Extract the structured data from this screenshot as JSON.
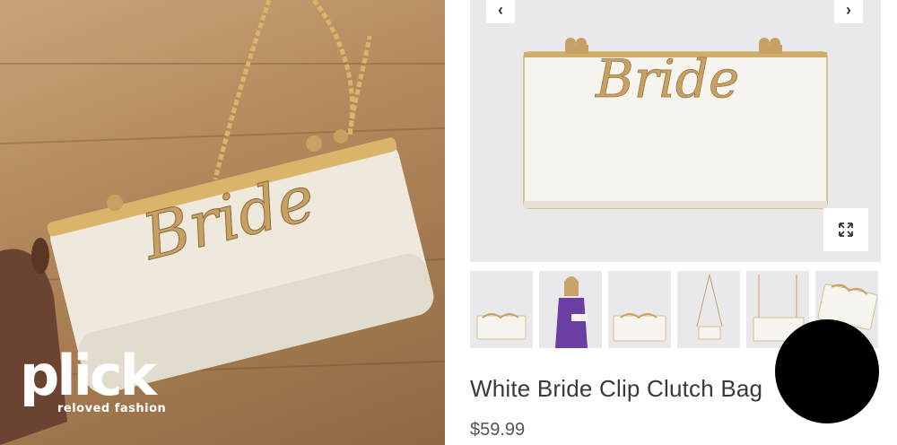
{
  "photo": {
    "brand": {
      "word": "plick",
      "tagline": "reloved fashion"
    },
    "bag_lettering": "Bride"
  },
  "gallery": {
    "prev_icon": "chevron-left-icon",
    "next_icon": "chevron-right-icon",
    "prev_glyph": "‹",
    "next_glyph": "›",
    "expand_icon": "expand-arrows-icon",
    "bag_lettering": "Bride"
  },
  "thumbnails": [
    {
      "kind": "clutch-front"
    },
    {
      "kind": "model-wearing"
    },
    {
      "kind": "clutch-front"
    },
    {
      "kind": "chain-strap"
    },
    {
      "kind": "chain-strap"
    },
    {
      "kind": "clutch-angle"
    }
  ],
  "product": {
    "title": "White Bride Clip Clutch Bag",
    "price": "$59.99"
  },
  "colors": {
    "gold": "#c9a063",
    "bag_cream": "#f3efe6",
    "background_grey": "#e9e9ec",
    "text": "#3a3a3a"
  }
}
